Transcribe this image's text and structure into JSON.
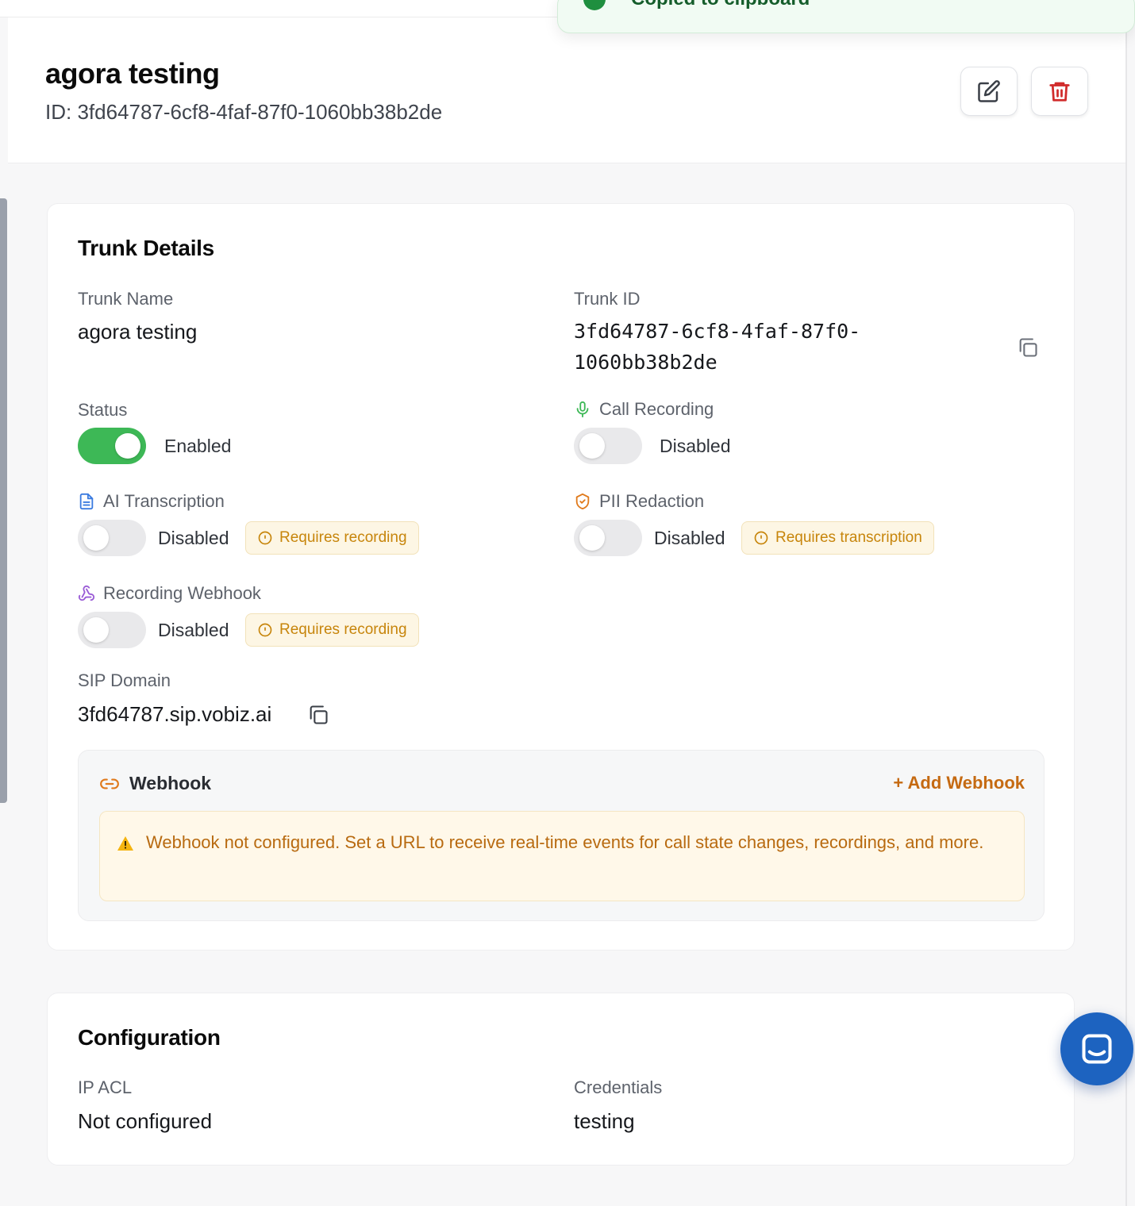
{
  "toast": {
    "text": "Copied to clipboard"
  },
  "header": {
    "title": "agora testing",
    "id_line": "ID: 3fd64787-6cf8-4faf-87f0-1060bb38b2de",
    "edit_icon": "pencil-square-icon",
    "delete_icon": "trash-icon"
  },
  "trunk_details": {
    "title": "Trunk Details",
    "trunk_name": {
      "label": "Trunk Name",
      "value": "agora testing"
    },
    "trunk_id": {
      "label": "Trunk ID",
      "value_line1": "3fd64787-6cf8-4faf-87f0-",
      "value_line2": "1060bb38b2de"
    },
    "status": {
      "label": "Status",
      "state": "Enabled",
      "on": true
    },
    "call_recording": {
      "label": "Call Recording",
      "icon": "microphone-icon",
      "state": "Disabled",
      "on": false
    },
    "ai_transcription": {
      "label": "AI Transcription",
      "icon": "document-icon",
      "state": "Disabled",
      "on": false,
      "badge": "Requires recording"
    },
    "pii_redaction": {
      "label": "PII Redaction",
      "icon": "shield-icon",
      "state": "Disabled",
      "on": false,
      "badge": "Requires transcription"
    },
    "recording_webhook": {
      "label": "Recording Webhook",
      "icon": "webhook-icon",
      "state": "Disabled",
      "on": false,
      "badge": "Requires recording"
    },
    "sip_domain": {
      "label": "SIP Domain",
      "value": "3fd64787.sip.vobiz.ai"
    },
    "webhook": {
      "title": "Webhook",
      "add_label": "+ Add Webhook",
      "warning": "Webhook not configured. Set a URL to receive real-time events for call state changes, recordings, and more."
    }
  },
  "configuration": {
    "title": "Configuration",
    "ip_acl": {
      "label": "IP ACL",
      "value": "Not configured"
    },
    "credentials": {
      "label": "Credentials",
      "value": "testing"
    }
  },
  "colors": {
    "toggle_on": "#3db856",
    "warning_text": "#c7850b",
    "accent_orange": "#c56a12",
    "delete_red": "#d12b2b",
    "chat_blue": "#1d63c0"
  }
}
